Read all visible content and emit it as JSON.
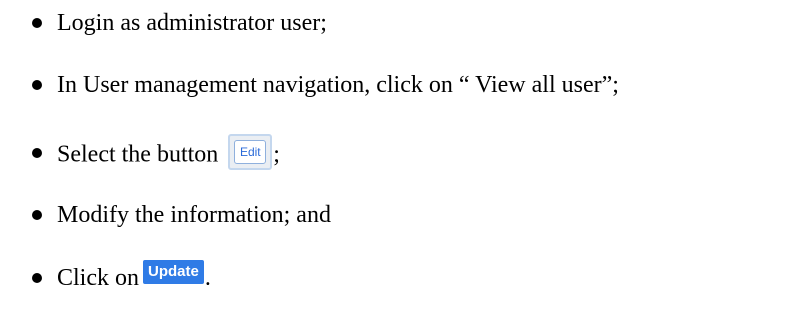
{
  "steps": [
    {
      "text": "Login as administrator user;"
    },
    {
      "text": "In User management navigation, click on “ View all user”;"
    },
    {
      "text_before": "Select the button",
      "button_label": "Edit",
      "text_after": ";"
    },
    {
      "text": "Modify the information; and"
    },
    {
      "text_before": "Click on",
      "button_label": "Update",
      "text_after": "."
    }
  ],
  "colors": {
    "edit_button_text": "#2a6ad8",
    "edit_button_border": "#8fb0dd",
    "update_button_background": "#2f7be6",
    "update_button_text": "#ffffff"
  }
}
